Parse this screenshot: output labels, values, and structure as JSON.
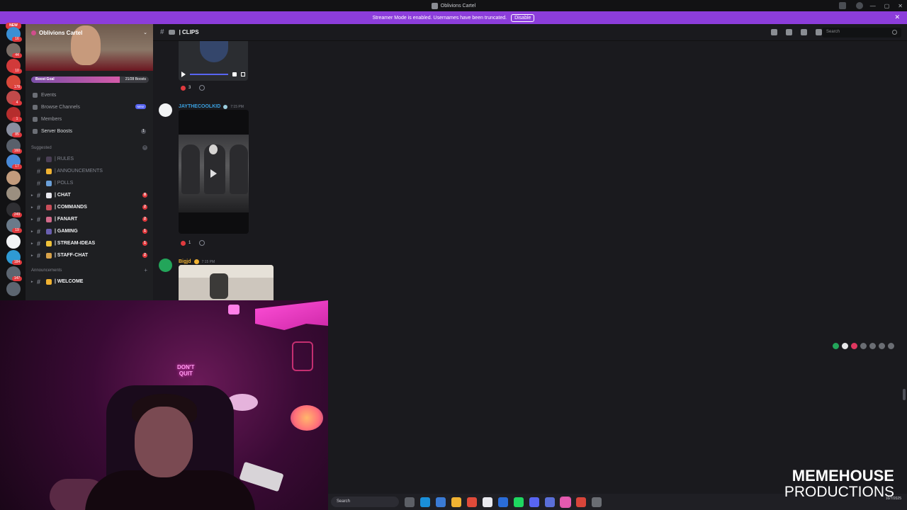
{
  "window": {
    "title": "Oblivions Cartel",
    "controls": [
      "—",
      "▢",
      "✕"
    ]
  },
  "banner": {
    "message": "Streamer Mode is enabled. Usernames have been truncated.",
    "disable_label": "Disable"
  },
  "rail": {
    "new_label": "NEW",
    "servers": [
      {
        "color": "#3a8fd4",
        "badge": "16"
      },
      {
        "color": "#7a6d66",
        "badge": "44"
      },
      {
        "color": "#d13a3a",
        "badge": "10"
      },
      {
        "color": "#d9483a",
        "badge": "178"
      },
      {
        "color": "#c14a4a",
        "badge": "4"
      },
      {
        "color": "#b62d2d",
        "badge": "1"
      },
      {
        "color": "#8a8fa0",
        "badge": "85"
      },
      {
        "color": "#59606b",
        "badge": "160"
      },
      {
        "color": "#4a8ad8",
        "badge": "17"
      },
      {
        "color": "#c29b7c",
        "badge": ""
      },
      {
        "color": "#9b8f80",
        "badge": ""
      },
      {
        "color": "#2f2f33",
        "badge": "249"
      },
      {
        "color": "#6a7a8a",
        "badge": "19"
      },
      {
        "color": "#f2f3f5",
        "badge": ""
      },
      {
        "color": "#2f9ad4",
        "badge": "184"
      },
      {
        "color": "#5c6570",
        "badge": "147"
      },
      {
        "color": "#5c6570",
        "badge": ""
      }
    ]
  },
  "sidebar": {
    "server_name": "Oblivions Cartel",
    "boost": {
      "label": "Boost Goal",
      "count": "21/28 Boosts",
      "progress": 0.75
    },
    "nav": [
      {
        "label": "Events",
        "name": "nav-events",
        "bright": false,
        "extra": ""
      },
      {
        "label": "Browse Channels",
        "name": "nav-browse-channels",
        "bright": false,
        "extra": "NEW"
      },
      {
        "label": "Members",
        "name": "nav-members",
        "bright": false,
        "extra": ""
      },
      {
        "label": "Server Boosts",
        "name": "nav-server-boosts",
        "bright": true,
        "extra": "1"
      }
    ],
    "suggested_label": "Suggested",
    "channels": [
      {
        "label": "| RULES",
        "unread": false,
        "mention": "",
        "emoji": "#4a3f55"
      },
      {
        "label": "| ANNOUNCEMENTS",
        "unread": false,
        "mention": "",
        "emoji": "#f0b232"
      },
      {
        "label": "| POLLS",
        "unread": false,
        "mention": "",
        "emoji": "#6a9fd8"
      },
      {
        "label": "| CHAT",
        "unread": true,
        "mention": "8",
        "emoji": "#e9e9ef"
      },
      {
        "label": "| COMMANDS",
        "unread": true,
        "mention": "2",
        "emoji": "#c84d59"
      },
      {
        "label": "| FANART",
        "unread": true,
        "mention": "2",
        "emoji": "#d26a8a"
      },
      {
        "label": "| GAMING",
        "unread": true,
        "mention": "1",
        "emoji": "#6a5fb0"
      },
      {
        "label": "| STREAM-IDEAS",
        "unread": true,
        "mention": "1",
        "emoji": "#f0c23a"
      },
      {
        "label": "| STAFF-CHAT",
        "unread": true,
        "mention": "2",
        "emoji": "#d8a24a"
      }
    ],
    "announcements_label": "Announcements",
    "welcome_channel": {
      "label": "| WELCOME",
      "emoji": "#f0b232"
    }
  },
  "channel_header": {
    "name": "| CLIPS",
    "search_placeholder": "Search"
  },
  "messages": [
    {
      "author": "JAYTHECOOLKID",
      "author_color": "#3aa0e0",
      "time": "7:15 PM",
      "avatar_color": "#f2f3f5"
    },
    {
      "author": "Bigjd",
      "author_color": "#f0b232",
      "time": "7:15 PM",
      "avatar_color": "#23a55a"
    }
  ],
  "reactions": [
    {
      "count": "3"
    },
    {
      "count": "1"
    }
  ],
  "hover_bar_colors": [
    "#23a55a",
    "#e8e8ea",
    "#e0375f",
    "#6a6d73",
    "#6a6d73",
    "#6a6d73",
    "#6a6d73"
  ],
  "webcam": {
    "sign_line1": "DON'T",
    "sign_line2": "QUIT"
  },
  "taskbar": {
    "search_label": "Search",
    "apps": [
      {
        "color": "#5c5f66",
        "active": false
      },
      {
        "color": "#1a8fd9",
        "active": false
      },
      {
        "color": "#3a7bd5",
        "active": false
      },
      {
        "color": "#f0b232",
        "active": false
      },
      {
        "color": "#e04b3a",
        "active": false
      },
      {
        "color": "#e9e9ef",
        "active": false
      },
      {
        "color": "#2a6cd8",
        "active": false
      },
      {
        "color": "#1ed760",
        "active": false
      },
      {
        "color": "#5865f2",
        "active": false
      },
      {
        "color": "#5a6fd8",
        "active": false
      },
      {
        "color": "#e55ab0",
        "active": true
      },
      {
        "color": "#d8453a",
        "active": false
      },
      {
        "color": "#6a6d73",
        "active": false
      }
    ],
    "date": "10/7/2025"
  },
  "watermark": {
    "line1": "MEMEHOUSE",
    "line2": "PRODUCTIONS"
  }
}
